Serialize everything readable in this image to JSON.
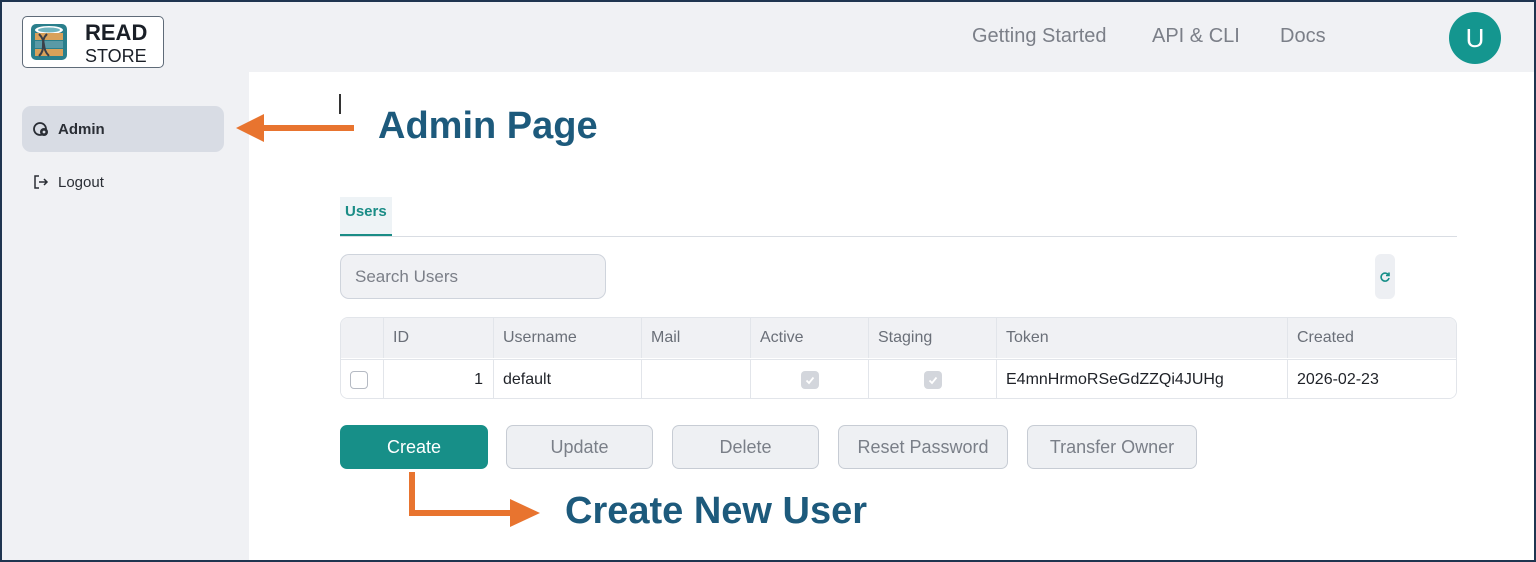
{
  "header": {
    "logo_line1": "READ",
    "logo_line2": "STORE",
    "nav": [
      "Getting Started",
      "API & CLI",
      "Docs"
    ],
    "avatar_letter": "U"
  },
  "sidebar": {
    "items": [
      {
        "label": "Admin",
        "icon": "admin-gear-icon",
        "active": true
      },
      {
        "label": "Logout",
        "icon": "logout-icon",
        "active": false
      }
    ]
  },
  "annotations": {
    "admin_page": "Admin Page",
    "create_new_user": "Create New User",
    "arrow_color": "#e8742f",
    "text_color": "#1d5a7c"
  },
  "tabs": {
    "users": "Users"
  },
  "search": {
    "placeholder": "Search Users"
  },
  "table": {
    "headers": [
      "ID",
      "Username",
      "Mail",
      "Active",
      "Staging",
      "Token",
      "Created"
    ],
    "rows": [
      {
        "id": "1",
        "username": "default",
        "mail": "",
        "active": true,
        "staging": true,
        "token": "E4mnHrmoRSeGdZZQi4JUHg",
        "created": "2026-02-23"
      }
    ]
  },
  "buttons": {
    "create": "Create",
    "update": "Update",
    "delete": "Delete",
    "reset_password": "Reset Password",
    "transfer_owner": "Transfer Owner"
  },
  "colors": {
    "accent": "#178f88",
    "avatar": "#14968f"
  }
}
